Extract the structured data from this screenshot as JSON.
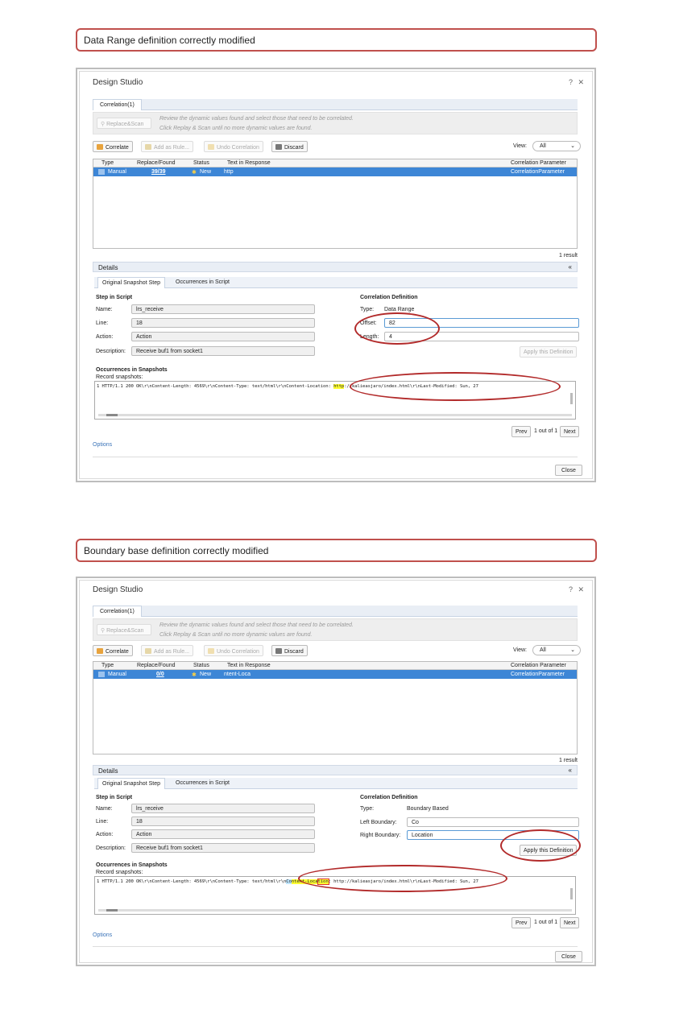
{
  "captions": {
    "first": "Data Range definition correctly modified",
    "second": "Boundary base definition correctly modified"
  },
  "dialog": {
    "title": "Design Studio",
    "help_icon": "?",
    "close_icon": "✕",
    "tab_label": "Correlation(1)",
    "replace_scan_label": "Replace&Scan",
    "info_line1": "Review the dynamic values found and select those that need to be correlated.",
    "info_line2": "Click Replay & Scan until no more dynamic values are found.",
    "toolbar": {
      "correlate": "Correlate",
      "add_as_rule": "Add as Rule...",
      "undo_correlation": "Undo Correlation",
      "discard": "Discard",
      "view_label": "View:",
      "view_value": "All"
    },
    "grid_headers": [
      "Type",
      "Replace/Found",
      "Status",
      "Text in Response",
      "Correlation Parameter"
    ],
    "result_count": "1 result",
    "details_label": "Details",
    "collapse_icon": "«",
    "subtabs": [
      "Original Snapshot Step",
      "Occurrences in Script"
    ],
    "step_in_script": "Step in Script",
    "name_label": "Name:",
    "name_value": "lrs_receive",
    "line_label": "Line:",
    "line_value": "18",
    "action_label": "Action:",
    "action_value": "Action",
    "description_label": "Description:",
    "description_value": "Receive buf1 from socket1",
    "correlation_definition": "Correlation Definition",
    "type_label": "Type:",
    "apply_button": "Apply this Definition",
    "occurrences_title": "Occurrences in Snapshots",
    "record_snapshots": "Record snapshots:",
    "prev": "Prev",
    "page_info": "1 out of 1",
    "next": "Next",
    "options": "Options",
    "close_button": "Close"
  },
  "panel1": {
    "row": {
      "type": "Manual",
      "replace_found": "39/39",
      "status": "New",
      "text": "http",
      "param": "CorrelationParameter"
    },
    "def_type": "Data Range",
    "offset_label": "Offset:",
    "offset_value": "82",
    "length_label": "Length:",
    "length_value": "4",
    "snap_before": "1 HTTP/1.1 200 OK\\r\\nContent-Length: 4569\\r\\nContent-Type: text/html\\r\\nContent-Location: ",
    "snap_hl": "http",
    "snap_after": "://kalieasjaro/index.html\\r\\nLast-Modified: Sun, 27"
  },
  "panel2": {
    "row": {
      "type": "Manual",
      "replace_found": "0/0",
      "status": "New",
      "text": "ntent-Loca",
      "param": "CorrelationParameter"
    },
    "def_type": "Boundary Based",
    "left_label": "Left Boundary:",
    "left_value": "Co",
    "right_label": "Right Boundary:",
    "right_value": "Location",
    "snap_before": "1 HTTP/1.1 200 OK\\r\\nContent-Length: 4569\\r\\nContent-Type: text/html\\r\\n",
    "snap_co": "Co",
    "snap_hl": "ntent-Loca",
    "snap_loc": "tion",
    "snap_after": ": http://kalieasjaro/index.html\\r\\nLast-Modified: Sun, 27"
  },
  "colors": {
    "selection": "#3d86d6",
    "annotation": "#b22a2a",
    "caption_border": "#c0504d"
  },
  "icons": [
    "search-icon",
    "correlate-icon",
    "rule-icon",
    "undo-icon",
    "discard-icon",
    "manual-type-icon",
    "new-status-icon",
    "help-icon",
    "close-icon",
    "collapse-icon"
  ]
}
